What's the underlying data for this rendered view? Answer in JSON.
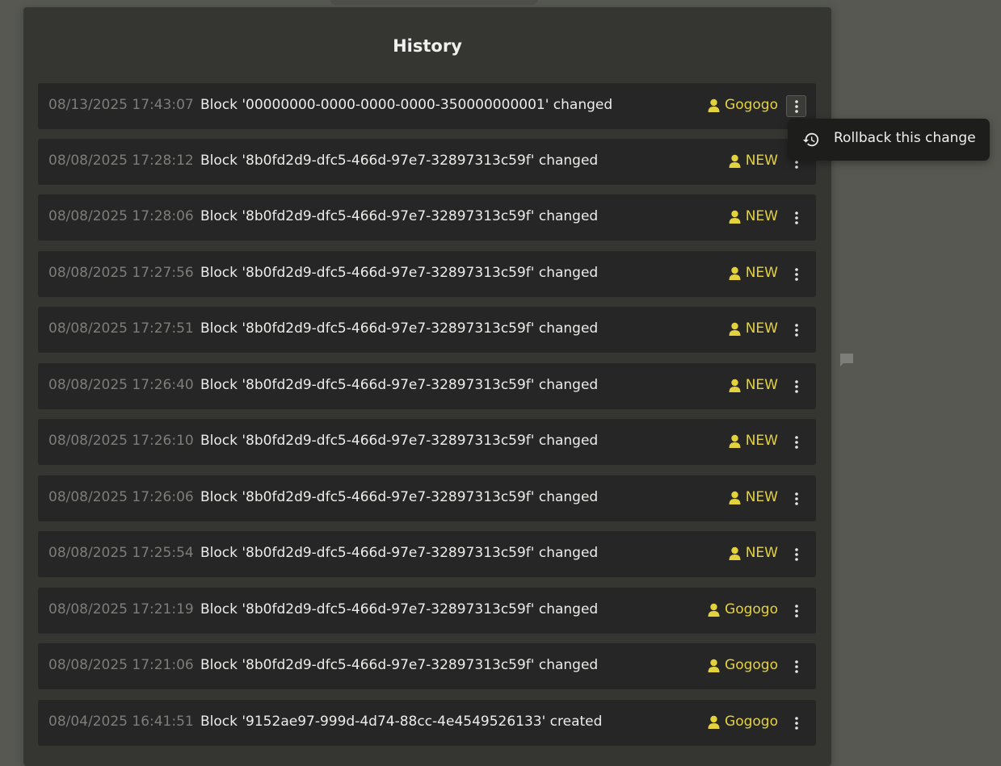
{
  "panel": {
    "title": "History"
  },
  "history": [
    {
      "timestamp": "08/13/2025 17:43:07",
      "message": "Block '00000000-0000-0000-0000-350000000001' changed",
      "user": "Gogogo",
      "menu_open": true
    },
    {
      "timestamp": "08/08/2025 17:28:12",
      "message": "Block '8b0fd2d9-dfc5-466d-97e7-32897313c59f' changed",
      "user": "NEW"
    },
    {
      "timestamp": "08/08/2025 17:28:06",
      "message": "Block '8b0fd2d9-dfc5-466d-97e7-32897313c59f' changed",
      "user": "NEW"
    },
    {
      "timestamp": "08/08/2025 17:27:56",
      "message": "Block '8b0fd2d9-dfc5-466d-97e7-32897313c59f' changed",
      "user": "NEW"
    },
    {
      "timestamp": "08/08/2025 17:27:51",
      "message": "Block '8b0fd2d9-dfc5-466d-97e7-32897313c59f' changed",
      "user": "NEW"
    },
    {
      "timestamp": "08/08/2025 17:26:40",
      "message": "Block '8b0fd2d9-dfc5-466d-97e7-32897313c59f' changed",
      "user": "NEW"
    },
    {
      "timestamp": "08/08/2025 17:26:10",
      "message": "Block '8b0fd2d9-dfc5-466d-97e7-32897313c59f' changed",
      "user": "NEW"
    },
    {
      "timestamp": "08/08/2025 17:26:06",
      "message": "Block '8b0fd2d9-dfc5-466d-97e7-32897313c59f' changed",
      "user": "NEW"
    },
    {
      "timestamp": "08/08/2025 17:25:54",
      "message": "Block '8b0fd2d9-dfc5-466d-97e7-32897313c59f' changed",
      "user": "NEW"
    },
    {
      "timestamp": "08/08/2025 17:21:19",
      "message": "Block '8b0fd2d9-dfc5-466d-97e7-32897313c59f' changed",
      "user": "Gogogo"
    },
    {
      "timestamp": "08/08/2025 17:21:06",
      "message": "Block '8b0fd2d9-dfc5-466d-97e7-32897313c59f' changed",
      "user": "Gogogo"
    },
    {
      "timestamp": "08/04/2025 16:41:51",
      "message": "Block '9152ae97-999d-4d74-88cc-4e4549526133' created",
      "user": "Gogogo"
    }
  ],
  "context_menu": {
    "item_label": "Rollback this change",
    "icon": "history-icon"
  },
  "colors": {
    "background": "#575852",
    "panel": "#353532",
    "row": "#262626",
    "user_accent": "#e3d23e",
    "timestamp": "#7d7d7a"
  }
}
